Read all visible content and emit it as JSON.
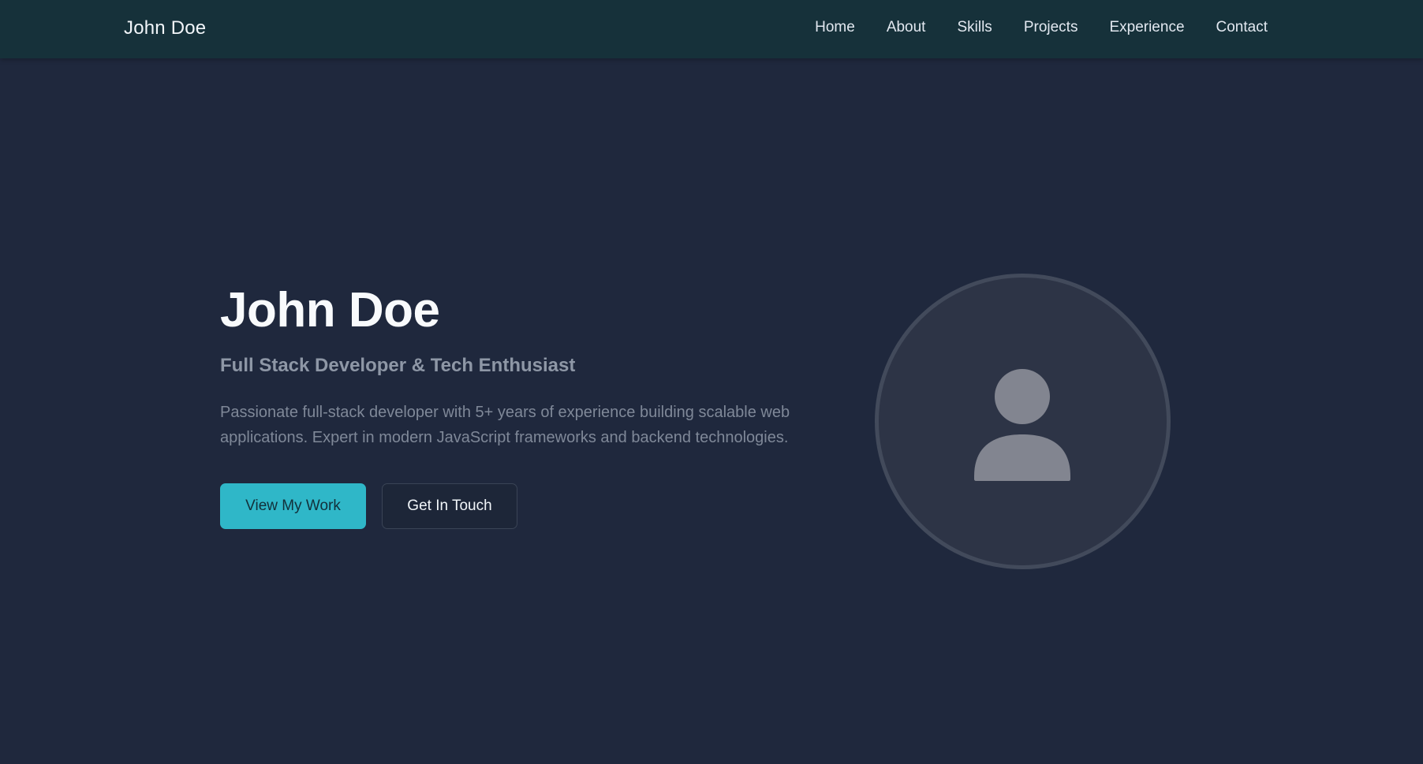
{
  "nav": {
    "brand": "John Doe",
    "links": [
      {
        "label": "Home"
      },
      {
        "label": "About"
      },
      {
        "label": "Skills"
      },
      {
        "label": "Projects"
      },
      {
        "label": "Experience"
      },
      {
        "label": "Contact"
      }
    ]
  },
  "hero": {
    "title": "John Doe",
    "subtitle": "Full Stack Developer & Tech Enthusiast",
    "description": "Passionate full-stack developer with 5+ years of experience building scalable web applications. Expert in modern JavaScript frameworks and backend technologies.",
    "primary_button": "View My Work",
    "secondary_button": "Get In Touch",
    "avatar_icon": "user-icon"
  },
  "colors": {
    "background": "#1f283d",
    "navbar": "#16313a",
    "accent": "#2fb7c8",
    "avatar_bg": "#2d3446",
    "avatar_border": "#424a5b",
    "avatar_icon": "#828590"
  }
}
